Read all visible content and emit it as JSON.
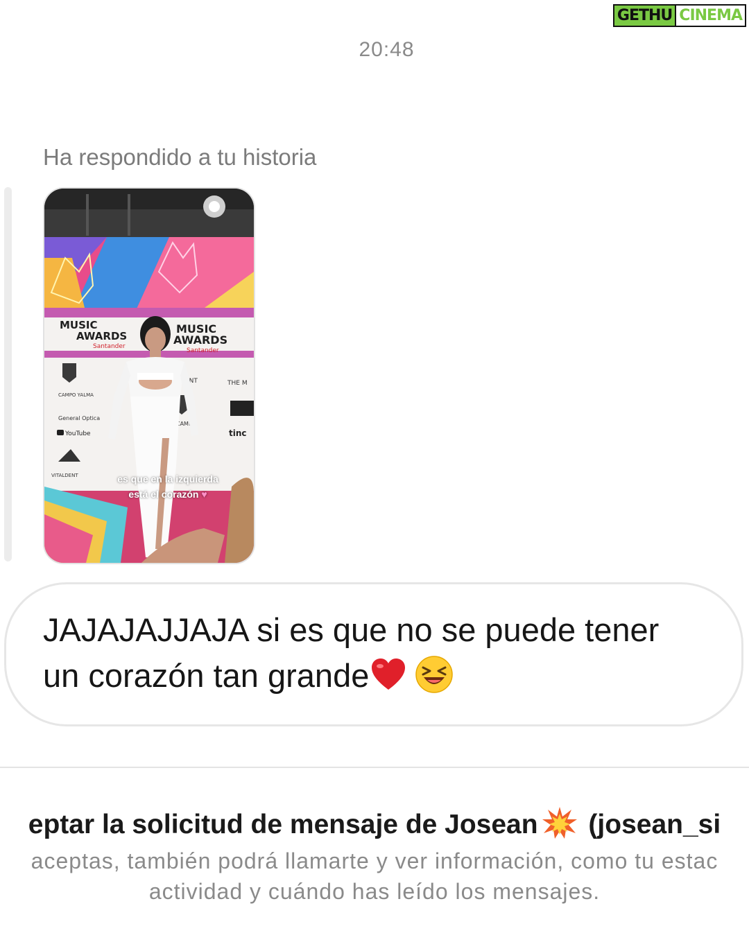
{
  "watermark": {
    "part1": "GETHU",
    "part2": "CINEMA"
  },
  "chat": {
    "timestamp": "20:48",
    "reply_note": "Ha respondido a tu historia",
    "story": {
      "caption_line1": "es que en la izquierda",
      "caption_line2": "está el corazón",
      "sign_left_brand": "MUSIC",
      "sign_left_brand2": "AWARDS",
      "sign_left_sponsor": "Santander",
      "sign_right_brand": "MUSIC",
      "sign_right_brand2": "AWARDS",
      "sign_right_sponsor": "Santander",
      "logo_talent": "TALDENT",
      "logo_the": "THE M",
      "logo_campo": "CAMPO YALMA",
      "logo_general": "General Optica",
      "logo_youtube": "YouTube",
      "logo_vitaldent": "VITALDENT",
      "logo_tinc": "tinc"
    },
    "message": {
      "line1": "JAJAJAJJAJA si es que no se puede tener",
      "line2": "un corazón tan grande"
    }
  },
  "request": {
    "title_before": "eptar la solicitud de mensaje de Josean",
    "title_after": "(josean_si",
    "desc_line1": "aceptas, también podrá llamarte y ver información, como tu estac",
    "desc_line2": "actividad y cuándo has leído los mensajes."
  },
  "colors": {
    "timestamp": "#8a8a8a",
    "bubble_border": "#e6e6e6",
    "text": "#161616",
    "muted": "#8a8a8a",
    "heart": "#e0202a",
    "watermark_green": "#7ac943"
  }
}
